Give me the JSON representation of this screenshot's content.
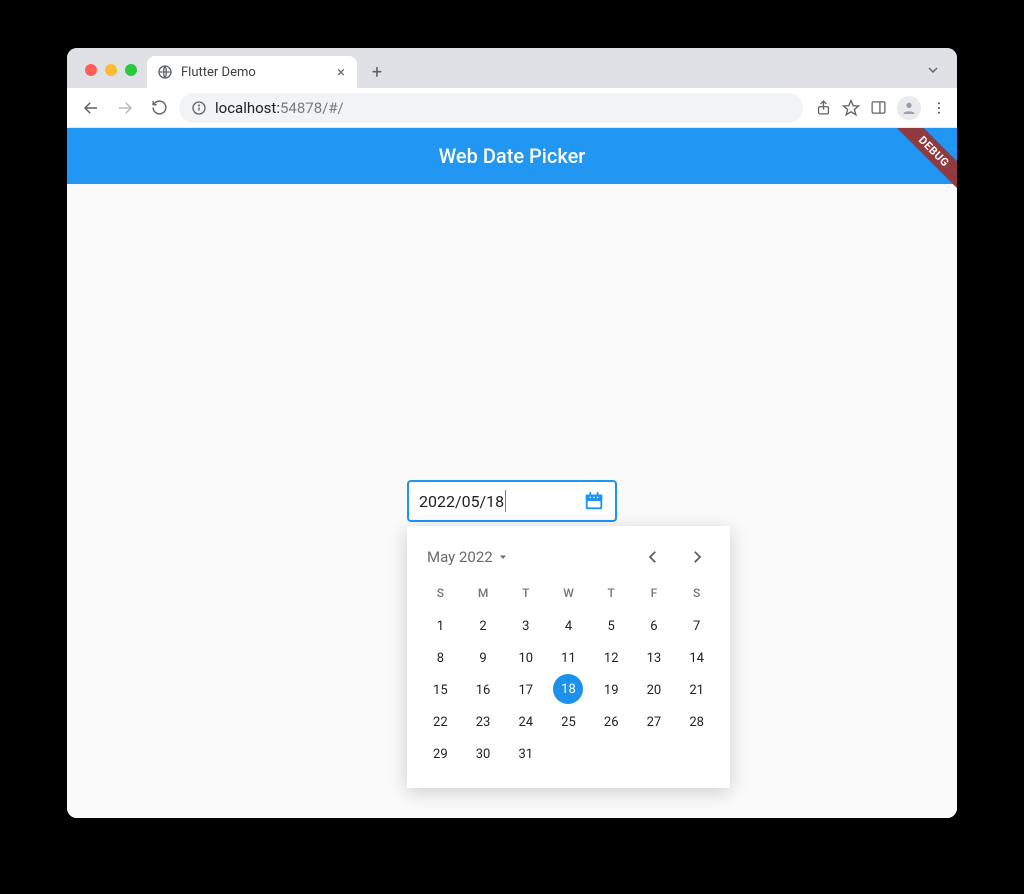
{
  "browser": {
    "tab_title": "Flutter Demo",
    "url_host": "localhost:",
    "url_rest": "54878/#/"
  },
  "app": {
    "title": "Web Date Picker",
    "debug_banner": "DEBUG"
  },
  "date_input": {
    "value": "2022/05/18"
  },
  "calendar": {
    "month_label": "May 2022",
    "dow": [
      "S",
      "M",
      "T",
      "W",
      "T",
      "F",
      "S"
    ],
    "leading_blanks": 0,
    "days": [
      1,
      2,
      3,
      4,
      5,
      6,
      7,
      8,
      9,
      10,
      11,
      12,
      13,
      14,
      15,
      16,
      17,
      18,
      19,
      20,
      21,
      22,
      23,
      24,
      25,
      26,
      27,
      28,
      29,
      30,
      31
    ],
    "selected_day": 18
  },
  "colors": {
    "accent": "#2196f3"
  }
}
